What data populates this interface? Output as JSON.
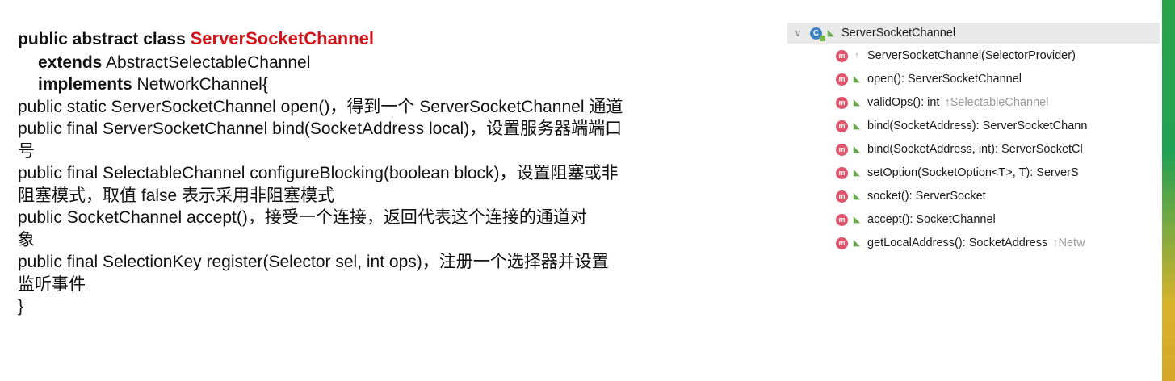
{
  "doc": {
    "class_line": {
      "prefix": "public abstract class ",
      "name": "ServerSocketChannel"
    },
    "extends_kw": "extends",
    "extends_val": " AbstractSelectableChannel",
    "implements_kw": "implements",
    "implements_val": " NetworkChannel{",
    "lines": [
      "public static ServerSocketChannel open()，得到一个 ServerSocketChannel 通道",
      "public final ServerSocketChannel bind(SocketAddress local)，设置服务器端端口",
      "号",
      "public final SelectableChannel configureBlocking(boolean block)，设置阻塞或非",
      "阻塞模式，取值 false 表示采用非阻塞模式",
      "public SocketChannel accept()，接受一个连接，返回代表这个连接的通道对",
      "象",
      "public final SelectionKey register(Selector sel, int ops)，注册一个选择器并设置",
      "监听事件",
      "}"
    ]
  },
  "structure": {
    "class_name": "ServerSocketChannel",
    "members": [
      {
        "text": "ServerSocketChannel(SelectorProvider)",
        "hint": ""
      },
      {
        "text": "open(): ServerSocketChannel",
        "hint": ""
      },
      {
        "text": "validOps(): int",
        "hint": "↑SelectableChannel"
      },
      {
        "text": "bind(SocketAddress): ServerSocketChann",
        "hint": ""
      },
      {
        "text": "bind(SocketAddress, int): ServerSocketCl",
        "hint": ""
      },
      {
        "text": "setOption(SocketOption<T>, T): ServerS",
        "hint": ""
      },
      {
        "text": "socket(): ServerSocket",
        "hint": ""
      },
      {
        "text": "accept(): SocketChannel",
        "hint": ""
      },
      {
        "text": "getLocalAddress(): SocketAddress",
        "hint": "↑Netw"
      }
    ]
  }
}
